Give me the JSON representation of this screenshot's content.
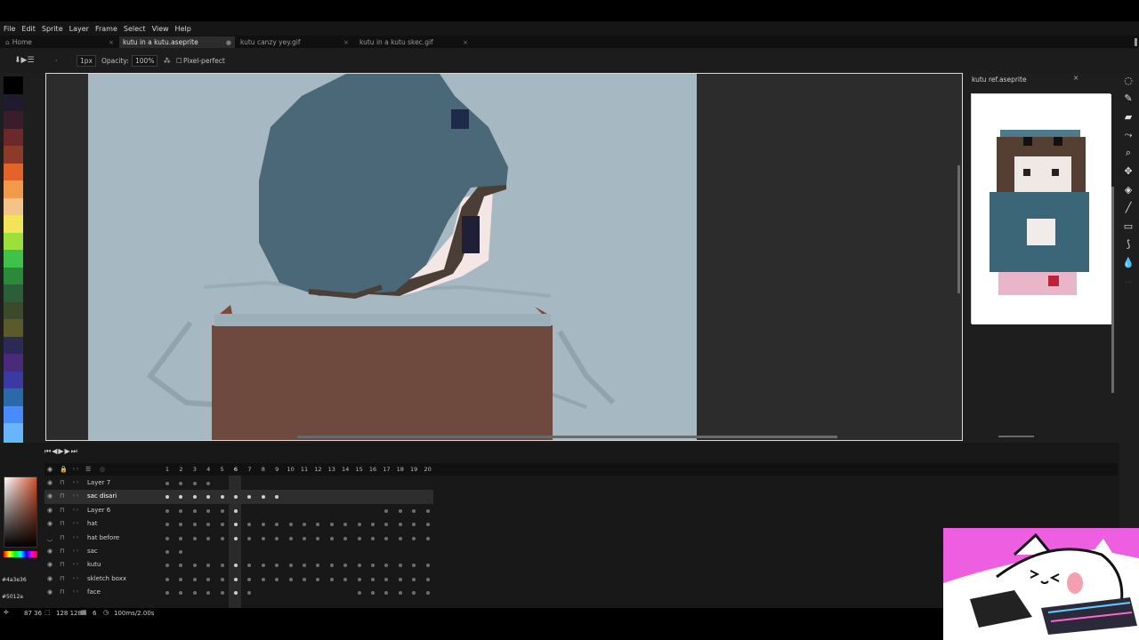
{
  "menu": [
    "File",
    "Edit",
    "Sprite",
    "Layer",
    "Frame",
    "Select",
    "View",
    "Help"
  ],
  "tabs": [
    {
      "label": "Home",
      "active": false
    },
    {
      "label": "kutu in a kutu.aseprite",
      "active": true
    },
    {
      "label": "kutu canzy yey.gif",
      "active": false
    },
    {
      "label": "kutu in a kutu skec.gif",
      "active": false
    }
  ],
  "toolbar": {
    "brush_size": "1px",
    "opacity_label": "Opacity:",
    "opacity_value": "100%",
    "pixel_perfect": "Pixel-perfect"
  },
  "palette": [
    "#000000",
    "#1f1a2e",
    "#3b1d2a",
    "#6a2a2a",
    "#8c3a2a",
    "#e3642b",
    "#f29a4a",
    "#f2c48a",
    "#f2e35a",
    "#9be03b",
    "#3ec24a",
    "#2a8a3a",
    "#2c5e3a",
    "#3a4a2a",
    "#5a5a2a",
    "#2a2a55",
    "#4a2a7a",
    "#3a3aa0",
    "#2a6aaa",
    "#4a8aff",
    "#6ab4ff",
    "#50c8e8",
    "#ffffff",
    "#c0c0c0",
    "#8a8a8a"
  ],
  "reference": {
    "title": "kutu ref.aseprite"
  },
  "timeline": {
    "frames": [
      "1",
      "2",
      "3",
      "4",
      "5",
      "6",
      "7",
      "8",
      "9",
      "10",
      "11",
      "12",
      "13",
      "14",
      "15",
      "16",
      "17",
      "18",
      "19",
      "20"
    ],
    "current_frame": 6,
    "layers": [
      {
        "name": "Layer 7",
        "visible": true,
        "active": false
      },
      {
        "name": "sac disari",
        "visible": true,
        "active": true
      },
      {
        "name": "Layer 6",
        "visible": true,
        "active": false
      },
      {
        "name": "hat",
        "visible": true,
        "active": false
      },
      {
        "name": "hat before",
        "visible": false,
        "active": false
      },
      {
        "name": "sac",
        "visible": true,
        "active": false
      },
      {
        "name": "kutu",
        "visible": true,
        "active": false
      },
      {
        "name": "skletch boxx",
        "visible": true,
        "active": false
      },
      {
        "name": "face",
        "visible": true,
        "active": false
      }
    ]
  },
  "colors": {
    "foreground": "#4a3e36",
    "background": "#5012a"
  },
  "color_labels": {
    "fg": "#4a3e36",
    "bg": "#5012a"
  },
  "status": {
    "coords": "87 36",
    "size": "128 128",
    "frame": "6",
    "duration": "100ms/2.00s"
  },
  "accent": "#ee5ee0"
}
